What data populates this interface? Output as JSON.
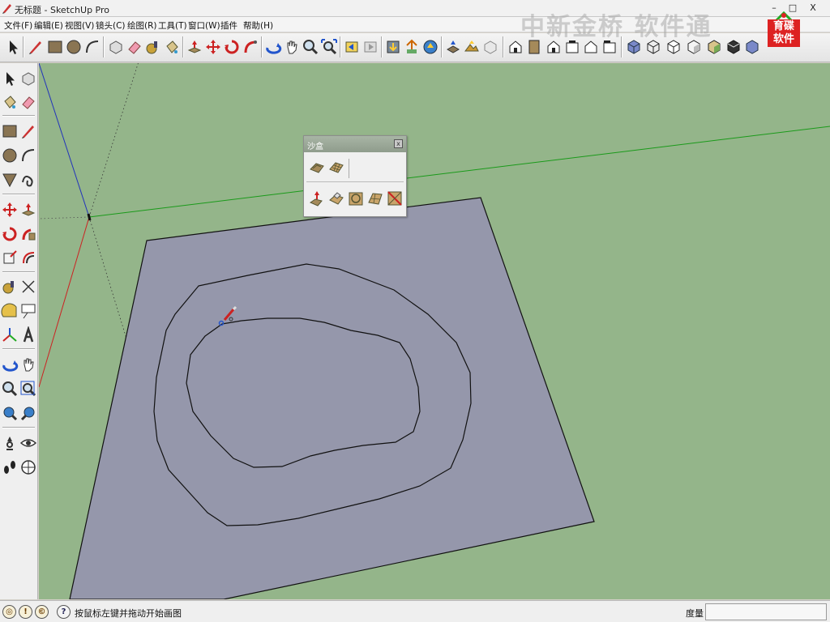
{
  "window": {
    "title": "无标题 - SketchUp Pro",
    "min_glyph": "–",
    "max_glyph": "□",
    "close_glyph": "X"
  },
  "menu": [
    "文件(F)",
    "编辑(E)",
    "视图(V)",
    "镜头(C)",
    "绘图(R)",
    "工具(T)",
    "窗口(W)",
    "插件",
    "帮助(H)"
  ],
  "watermark": "中新金桥 软件通",
  "logo": {
    "line1": "育碟",
    "line2": "软件"
  },
  "sandbox_panel": {
    "title": "沙盒",
    "close_glyph": "x",
    "row1_icons": [
      "from-contours-icon",
      "from-scratch-icon"
    ],
    "row2_icons": [
      "smoove-icon",
      "stamp-icon",
      "drape-icon",
      "add-detail-icon",
      "flip-edge-icon"
    ]
  },
  "status": {
    "hint": "按鼠标左键并拖动开始画图",
    "measure_label": "度量",
    "measure_value": ""
  },
  "colors": {
    "viewport_bg": "#94b58a",
    "ground_face": "#9597ab",
    "contour_line": "#111111",
    "axis_red": "#cc2222",
    "axis_green": "#1a9a1a",
    "axis_blue": "#2233bb"
  },
  "toolbar_icons": [
    "select-icon",
    "pencil-icon",
    "rectangle-icon",
    "circle-icon",
    "arc-icon",
    "make-component-icon",
    "eraser-icon",
    "tape-measure-icon",
    "paint-bucket-icon",
    "push-pull-icon",
    "move-icon",
    "rotate-icon",
    "follow-me-icon",
    "orbit-icon",
    "pan-icon",
    "zoom-icon",
    "zoom-extents-icon",
    "previous-view-icon",
    "next-view-icon",
    "get-models-icon",
    "share-model-icon",
    "share-component-icon",
    "add-location-icon",
    "toggle-terrain-icon",
    "photo-texture-icon",
    "preview-google-earth-icon",
    "iso-view-icon",
    "top-view-icon",
    "front-view-icon",
    "right-view-icon",
    "back-view-icon",
    "left-view-icon",
    "xray-icon",
    "wireframe-icon",
    "hidden-line-icon",
    "shaded-icon",
    "shaded-textures-icon",
    "monochrome-icon"
  ]
}
